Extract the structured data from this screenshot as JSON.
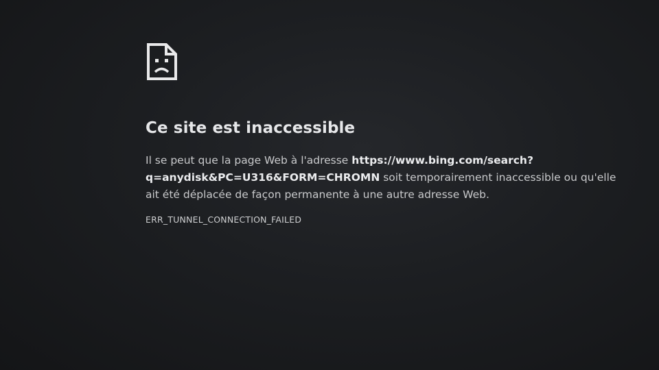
{
  "error": {
    "icon": "sad-page-icon",
    "title": "Ce site est inaccessible",
    "message_prefix": "Il se peut que la page Web à l'adresse ",
    "url": "https://www.bing.com/search?q=anydisk&PC=U316&FORM=CHROMN",
    "message_suffix": " soit temporairement inaccessible ou qu'elle ait été déplacée de façon permanente à une autre adresse Web.",
    "code": "ERR_TUNNEL_CONNECTION_FAILED"
  },
  "colors": {
    "background": "#1c1e21",
    "text": "#c9cacc",
    "heading": "#e6e7e9"
  }
}
